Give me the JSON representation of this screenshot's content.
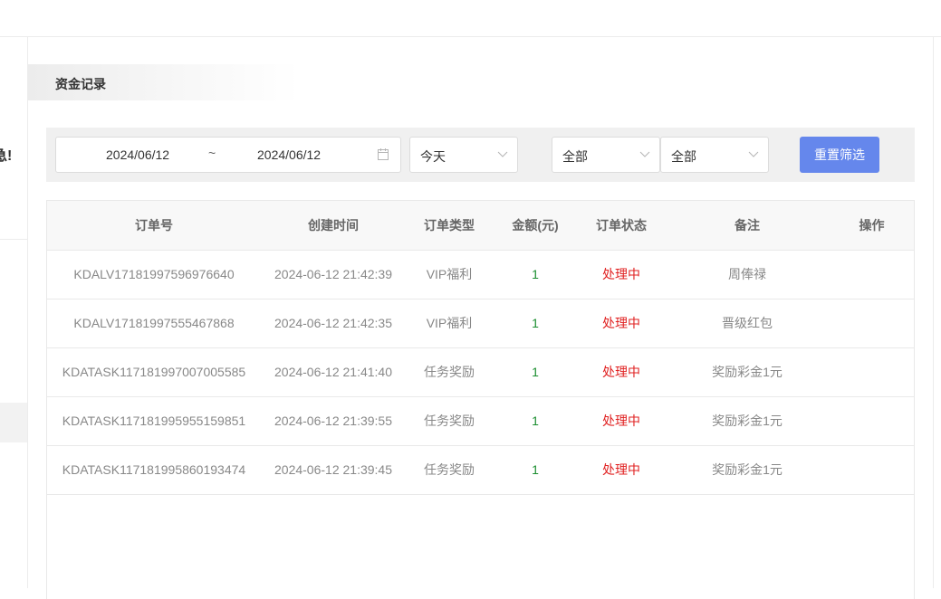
{
  "sidebar": {
    "clipped_text": "急!"
  },
  "page": {
    "section_title": "资金记录"
  },
  "filters": {
    "date_start": "2024/06/12",
    "date_separator": "~",
    "date_end": "2024/06/12",
    "range_select": "今天",
    "select_a": "全部",
    "select_b": "全部",
    "reset_label": "重置筛选"
  },
  "table": {
    "headers": [
      "订单号",
      "创建时间",
      "订单类型",
      "金额(元)",
      "订单状态",
      "备注",
      "操作"
    ],
    "rows": [
      {
        "order_no": "KDALV17181997596976640",
        "created": "2024-06-12 21:42:39",
        "type": "VIP福利",
        "amount": "1",
        "status": "处理中",
        "note": "周俸禄",
        "action": ""
      },
      {
        "order_no": "KDALV17181997555467868",
        "created": "2024-06-12 21:42:35",
        "type": "VIP福利",
        "amount": "1",
        "status": "处理中",
        "note": "晋级红包",
        "action": ""
      },
      {
        "order_no": "KDATASK117181997007005585",
        "created": "2024-06-12 21:41:40",
        "type": "任务奖励",
        "amount": "1",
        "status": "处理中",
        "note": "奖励彩金1元",
        "action": ""
      },
      {
        "order_no": "KDATASK117181995955159851",
        "created": "2024-06-12 21:39:55",
        "type": "任务奖励",
        "amount": "1",
        "status": "处理中",
        "note": "奖励彩金1元",
        "action": ""
      },
      {
        "order_no": "KDATASK117181995860193474",
        "created": "2024-06-12 21:39:45",
        "type": "任务奖励",
        "amount": "1",
        "status": "处理中",
        "note": "奖励彩金1元",
        "action": ""
      }
    ]
  },
  "colors": {
    "accent": "#6587ec",
    "amount": "#1a8d2f",
    "status_processing": "#e02020"
  },
  "icons": {
    "date": "calendar-icon",
    "select": "chevron-down-icon"
  }
}
